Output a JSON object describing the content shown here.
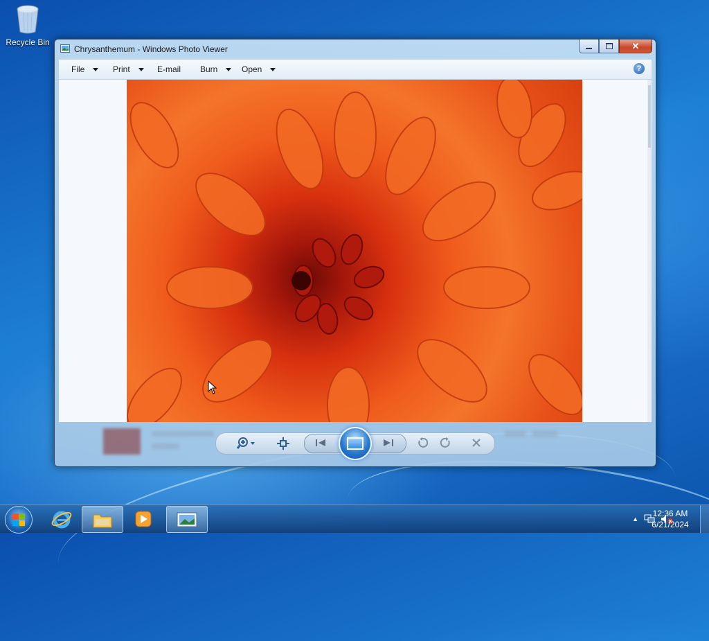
{
  "desktop": {
    "icons": [
      {
        "label": "Recycle Bin",
        "icon": "recycle-bin-icon"
      }
    ]
  },
  "window": {
    "title": "Chrysanthemum - Windows Photo Viewer",
    "app_icon": "photo-viewer-icon",
    "caption_buttons": {
      "minimize": "minimize-icon",
      "maximize": "maximize-icon",
      "close": "close-icon"
    },
    "menu": [
      {
        "label": "File",
        "dropdown": true
      },
      {
        "label": "Print",
        "dropdown": true
      },
      {
        "label": "E-mail",
        "dropdown": false
      },
      {
        "label": "Burn",
        "dropdown": true
      },
      {
        "label": "Open",
        "dropdown": true
      }
    ],
    "help_icon": "help-icon",
    "photo": {
      "subject": "chrysanthemum-photo",
      "colors": {
        "center": "#6e0b06",
        "petals": "#ef5a1c"
      }
    },
    "controls": [
      "zoom-icon",
      "actual-size-icon",
      "previous-icon",
      "slideshow-icon",
      "next-icon",
      "rotate-counterclockwise-icon",
      "rotate-clockwise-icon",
      "delete-icon"
    ]
  },
  "taskbar": {
    "pinned": [
      "start-orb",
      "internet-explorer-icon",
      "windows-explorer-icon",
      "media-player-icon",
      "photo-viewer-icon"
    ],
    "tray_icons": [
      "show-hidden-icons-icon",
      "network-icon",
      "volume-muted-icon"
    ],
    "time": "12:36 AM",
    "date": "6/21/2024"
  },
  "colors": {
    "accent": "#1d7fd4",
    "close_button": "#c7472b"
  }
}
